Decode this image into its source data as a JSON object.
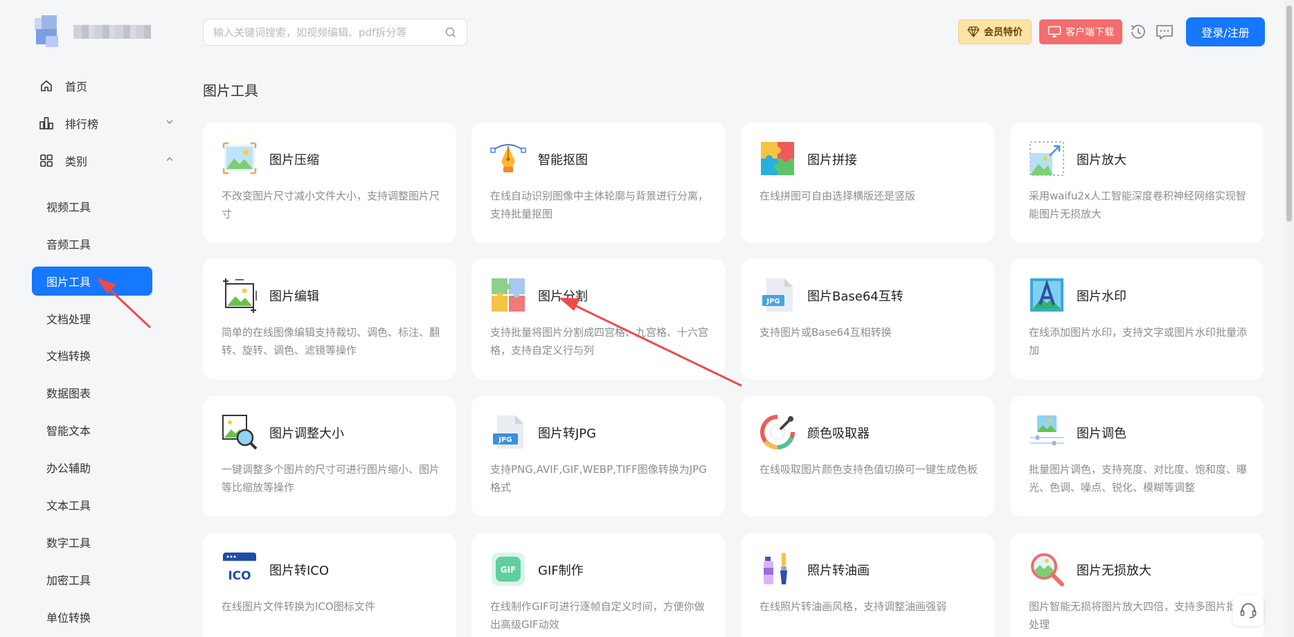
{
  "header": {
    "search_placeholder": "输入关键词搜索，如视频编辑、pdf拆分等",
    "vip_label": "会员特价",
    "client_label": "客户端下载",
    "login_label": "登录/注册"
  },
  "sidebar": {
    "top_items": [
      {
        "label": "首页",
        "icon": "home-icon"
      },
      {
        "label": "排行榜",
        "icon": "bar-chart-icon"
      },
      {
        "label": "类别",
        "icon": "grid-icon"
      }
    ],
    "sub_items": [
      {
        "label": "视频工具"
      },
      {
        "label": "音频工具"
      },
      {
        "label": "图片工具",
        "active": true
      },
      {
        "label": "文档处理"
      },
      {
        "label": "文档转换"
      },
      {
        "label": "数据图表"
      },
      {
        "label": "智能文本"
      },
      {
        "label": "办公辅助"
      },
      {
        "label": "文本工具"
      },
      {
        "label": "数字工具"
      },
      {
        "label": "加密工具"
      },
      {
        "label": "单位转换"
      }
    ]
  },
  "main": {
    "title": "图片工具",
    "cards": [
      {
        "title": "图片压缩",
        "desc": "不改变图片尺寸减小文件大小，支持调整图片尺寸",
        "icon": "image-compress-icon"
      },
      {
        "title": "智能抠图",
        "desc": "在线自动识别图像中主体轮廓与背景进行分离，支持批量抠图",
        "icon": "pen-tool-icon"
      },
      {
        "title": "图片拼接",
        "desc": "在线拼图可自由选择横版还是竖版",
        "icon": "puzzle-icon"
      },
      {
        "title": "图片放大",
        "desc": "采用waifu2x人工智能深度卷积神经网络实现智能图片无损放大",
        "icon": "image-enlarge-icon"
      },
      {
        "title": "图片编辑",
        "desc": "简单的在线图像编辑支持裁切、调色、标注、翻转、旋转、调色、滤镜等操作",
        "icon": "image-edit-icon"
      },
      {
        "title": "图片分割",
        "desc": "支持批量将图片分割成四宫格、九宫格、十六宫格，支持自定义行与列",
        "icon": "image-split-icon"
      },
      {
        "title": "图片Base64互转",
        "desc": "支持图片或Base64互相转换",
        "icon": "jpg-file-icon"
      },
      {
        "title": "图片水印",
        "desc": "在线添加图片水印，支持文字或图片水印批量添加",
        "icon": "watermark-icon"
      },
      {
        "title": "图片调整大小",
        "desc": "一键调整多个图片的尺寸可进行图片缩小、图片等比缩放等操作",
        "icon": "image-resize-icon"
      },
      {
        "title": "图片转JPG",
        "desc": "支持PNG,AVIF,GIF,WEBP,TIFF图像转换为JPG格式",
        "icon": "jpg-doc-icon"
      },
      {
        "title": "颜色吸取器",
        "desc": "在线吸取图片颜色支持色值切换可一键生成色板",
        "icon": "color-picker-icon"
      },
      {
        "title": "图片调色",
        "desc": "批量图片调色，支持亮度、对比度、饱和度、曝光、色调、噪点、锐化、模糊等调整",
        "icon": "image-adjust-icon"
      },
      {
        "title": "图片转ICO",
        "desc": "在线图片文件转换为ICO图标文件",
        "icon": "ico-icon"
      },
      {
        "title": "GIF制作",
        "desc": "在线制作GIF可进行逐帧自定义时间，方便你做出高级GIF动效",
        "icon": "gif-icon"
      },
      {
        "title": "照片转油画",
        "desc": "在线照片转油画风格，支持调整油画强弱",
        "icon": "oil-paint-icon"
      },
      {
        "title": "图片无损放大",
        "desc": "图片智能无损将图片放大四倍，支持多图片批量处理",
        "icon": "magnifier-icon"
      }
    ]
  },
  "colors": {
    "primary": "#1677ff",
    "client_red": "#f46c6c",
    "vip_gold": "#fde3a6",
    "annotation_arrow": "#ee4a4a"
  }
}
